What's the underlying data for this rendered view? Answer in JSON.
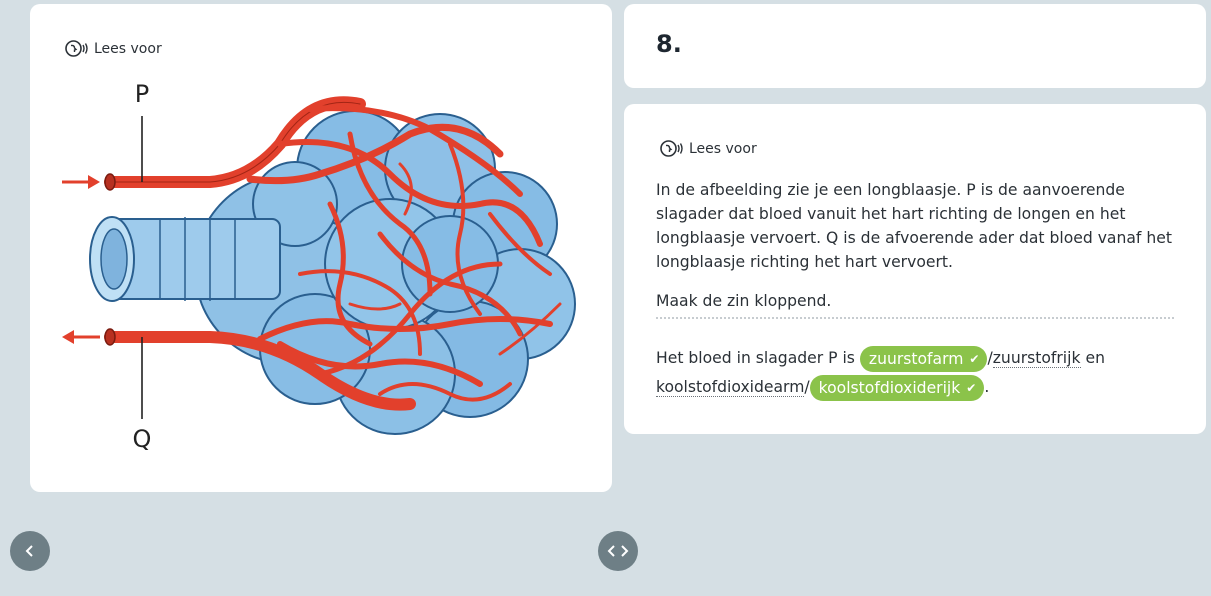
{
  "left": {
    "read_aloud": "Lees voor",
    "labels": {
      "p": "P",
      "q": "Q"
    }
  },
  "question": {
    "number": "8.",
    "read_aloud": "Lees voor",
    "intro": "In de afbeelding zie je een longblaasje. P is de aanvoerende slagader dat bloed vanuit het hart richting de longen en het longblaasje vervoert. Q is de afvoerende ader dat bloed vanaf het longblaasje richting het hart vervoert.",
    "instruction": "Maak de zin kloppend.",
    "sentence": {
      "part1": "Het bloed in slagader P is",
      "choice1_selected": "zuurstofarm",
      "slash": "/",
      "choice1_other": "zuurstofrijk",
      "part2": "en",
      "choice2_other": "koolstofdioxidearm",
      "choice2_selected": "koolstofdioxiderijk",
      "end": "."
    }
  },
  "colors": {
    "background": "#d5dfe4",
    "correct_pill": "#8bc34a",
    "nav_button": "#6e7f86",
    "vessel_red": "#e2402c",
    "alveolus_blue": "#7fb8e3"
  }
}
